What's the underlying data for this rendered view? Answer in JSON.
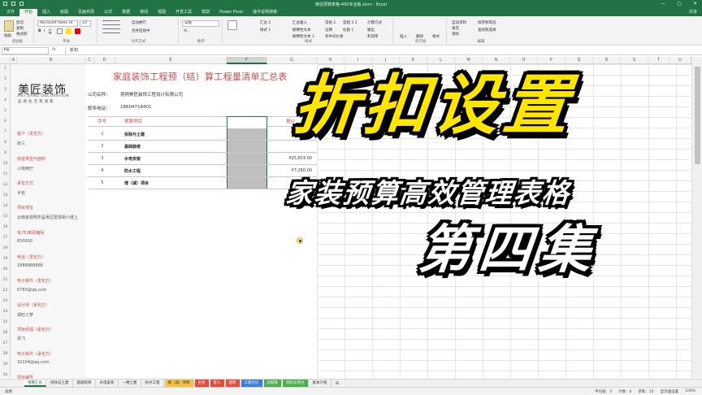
{
  "window": {
    "title": "微信预算表格-400专业版.xlsm  -  Excel",
    "controls": [
      "—",
      "▢",
      "✕"
    ]
  },
  "ribbon": {
    "tabs": [
      "文件",
      "开始",
      "插入",
      "绘图",
      "页面布局",
      "公式",
      "数据",
      "审阅",
      "视图",
      "开发工具",
      "帮助",
      "Power Pivot",
      "操作说明搜索"
    ],
    "active_tab": "开始",
    "share_label": "共享",
    "clipboard": {
      "paste": "粘贴",
      "cut": "剪切",
      "copy": "复制",
      "painter": "格式刷",
      "group": "剪贴板"
    },
    "font": {
      "name": "Microsoft YaHei UI",
      "size": "10",
      "group": "字体"
    },
    "alignment": {
      "wrap": "自动换行",
      "merge": "合并后居中",
      "group": "对齐方式"
    },
    "number": {
      "format": "常规",
      "group": "数字"
    },
    "styles": {
      "cells": [
        "汇总 2",
        "汇总输入",
        "常规 2",
        "常规 3 2",
        "计算方式",
        "样式 1",
        "解释性文本",
        "注释",
        "标题 1",
        "输出",
        "解释性文本 3",
        "有中间价格",
        "利润率"
      ],
      "group": "样式"
    },
    "cells_group": {
      "insert": "插入",
      "delete": "删除",
      "format": "格式",
      "group": "单元格"
    },
    "editing": {
      "sum": "自动求和",
      "fill": "填充",
      "clear": "清除",
      "sort": "排序和筛选",
      "find": "查找和选择",
      "group": "编辑"
    }
  },
  "formula_bar": {
    "name_box": "F4",
    "fx": "fx",
    "content": "折扣"
  },
  "columns": [
    "A",
    "B",
    "C",
    "D",
    "E",
    "F",
    "G",
    "H",
    "I",
    "J",
    "K",
    "L",
    "M",
    "N",
    "O",
    "P",
    "Q",
    "R",
    "S",
    "T",
    "U"
  ],
  "selected_column": "F",
  "rows": [
    "1",
    "2",
    "3",
    "4",
    "5",
    "6",
    "7",
    "8",
    "9",
    "10",
    "11",
    "12",
    "13",
    "14",
    "15",
    "16",
    "17",
    "18",
    "19",
    "20",
    "21",
    "22",
    "23",
    "24",
    "25",
    "26",
    "27",
    "28",
    "29",
    "30"
  ],
  "logo": {
    "cn": "美匠装饰",
    "en": "MEI JIANG DECORATION",
    "tagline": "品质生活我涵家"
  },
  "left_fields": [
    {
      "label": "客户（发包方）",
      "value": "张三"
    },
    {
      "label": "房屋类型与面积",
      "value": "三房两厅"
    },
    {
      "label": "承包方式",
      "value": "半包"
    },
    {
      "label": "项目地址",
      "value": "云南省昆明市呈贡区斑铁街小楼上"
    },
    {
      "label": "省/市/邮政编码",
      "value": "650000"
    },
    {
      "label": "电话（发包方）",
      "value": "1888888888"
    },
    {
      "label": "电子邮件（发包方）",
      "value": "6783@qq.com"
    },
    {
      "label": "设计师（承包方）",
      "value": "郑旺人梦"
    },
    {
      "label": "项目经理（承包方）",
      "value": "昆飞"
    },
    {
      "label": "电子邮件（承包方）",
      "value": "32104@qq.com"
    },
    {
      "label": "项目编号",
      "value": ""
    }
  ],
  "form": {
    "title": "家庭装饰工程预（结）算工程量清单汇总表",
    "company_label": "公司名称：",
    "company_value": "昆明美匠装饰工程设计有限公司",
    "phone_label": "联系电话：",
    "phone_value": "18604718401",
    "col_seq": "序号",
    "col_item": "预算项目",
    "col_amount": "报价",
    "items": [
      {
        "seq": "1",
        "name": "拆除与土建",
        "amount": ""
      },
      {
        "seq": "2",
        "name": "基础装修",
        "amount": ""
      },
      {
        "seq": "3",
        "name": "水电安装",
        "amount": "¥25,603.00"
      },
      {
        "seq": "4",
        "name": "防水工程",
        "amount": "¥7,260.00"
      },
      {
        "seq": "5",
        "name": "增（减）项目",
        "amount": ""
      }
    ]
  },
  "overlay": {
    "headline": "折扣设置",
    "subtitle": "家装预算高效管理表格",
    "episode": "第四集"
  },
  "sheet_tabs": [
    {
      "label": "预算汇总",
      "color": "#ffffff",
      "active": true
    },
    {
      "label": "拆除与土建",
      "color": "#f0f0f0"
    },
    {
      "label": "基础装修",
      "color": "#f0f0f0"
    },
    {
      "label": "水电安装",
      "color": "#f0f0f0"
    },
    {
      "label": "一楼土建",
      "color": "#f0f0f0"
    },
    {
      "label": "防水工程",
      "color": "#f0f0f0"
    },
    {
      "label": "增（减）项目",
      "color": "#f5c242"
    },
    {
      "label": "主材",
      "color": "#e84a3c"
    },
    {
      "label": "客人",
      "color": "#e84a3c"
    },
    {
      "label": "面积",
      "color": "#e84a3c"
    },
    {
      "label": "工程计价",
      "color": "#3f7fd6"
    },
    {
      "label": "问题库",
      "color": "#4caf50"
    },
    {
      "label": "材料与单位",
      "color": "#4caf50"
    },
    {
      "label": "基本介绍",
      "color": "#f0f0f0"
    }
  ],
  "status": {
    "left": "就绪",
    "average": "平均值：3",
    "count": "计数：6",
    "sum": "求和：15",
    "display": "显示器设置",
    "zoom": "100%"
  },
  "accent_color": "#217346"
}
